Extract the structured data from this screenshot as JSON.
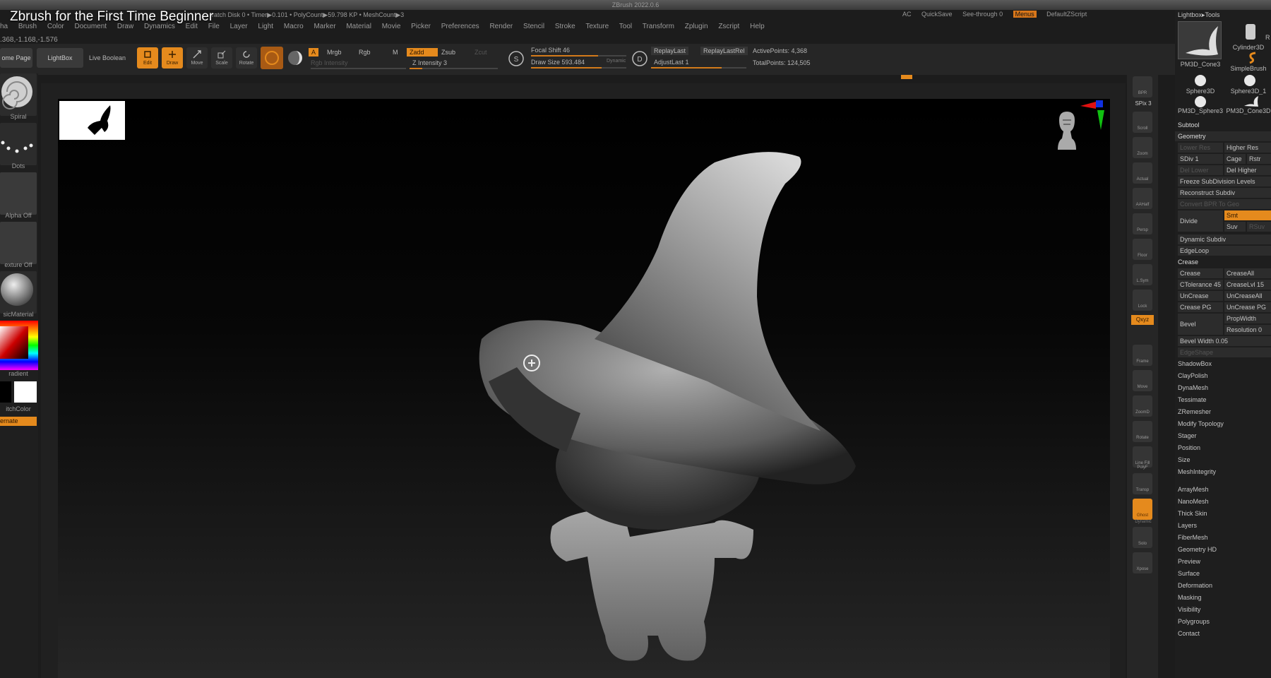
{
  "app": {
    "window_title": "ZBrush 2022.0.6",
    "video_title": "Zbrush for the First Time Beginner",
    "stats": "ratch Disk 0 •  Timer▶0.101 • PolyCount▶59.798 KP • MeshCount▶3",
    "right_info": {
      "ac": "AC",
      "quicksave": "QuickSave",
      "seethrough": "See-through  0",
      "menus": "Menus",
      "script": "DefaultZScript"
    }
  },
  "menubar": [
    "ha",
    "Brush",
    "Color",
    "Document",
    "Draw",
    "Dynamics",
    "Edit",
    "File",
    "Layer",
    "Light",
    "Macro",
    "Marker",
    "Material",
    "Movie",
    "Picker",
    "Preferences",
    "Render",
    "Stencil",
    "Stroke",
    "Texture",
    "Tool",
    "Transform",
    "Zplugin",
    "Zscript",
    "Help"
  ],
  "coords": ".368,-1.168,-1.576",
  "toolbar": {
    "home_page": "ome Page",
    "lightbox": "LightBox",
    "live_boolean": "Live Boolean",
    "tools": [
      {
        "label": "Edit",
        "on": true
      },
      {
        "label": "Draw",
        "on": true
      },
      {
        "label": "Move",
        "on": false
      },
      {
        "label": "Scale",
        "on": false
      },
      {
        "label": "Rotate",
        "on": false
      }
    ],
    "a": "A",
    "mrgb": "Mrgb",
    "rgb": "Rgb",
    "m": "M",
    "rgb_intensity": "Rgb Intensity",
    "zadd": "Zadd",
    "zsub": "Zsub",
    "zcut": "Zcut",
    "z_intensity": "Z Intensity 3",
    "focal_shift": "Focal Shift 46",
    "draw_size": "Draw Size 593.484",
    "dynamic": "Dynamic",
    "replay_last": "ReplayLast",
    "replay_last_rel": "ReplayLastRel",
    "adjust_last": "AdjustLast 1",
    "active_points": "ActivePoints: 4,368",
    "total_points": "TotalPoints: 124,505",
    "s_label": "S",
    "d_label": "D"
  },
  "left_shelf": {
    "brush": "Spiral",
    "stroke": "Dots",
    "alpha": "Alpha Off",
    "texture": "exture Off",
    "material": "sicMaterial",
    "gradient": "radient",
    "switch_color": "itchColor",
    "alternate": "ernate"
  },
  "right_strip": [
    "BPR",
    "SPix 3",
    "Scroll",
    "Zoom",
    "Actual",
    "AAHalf",
    "Persp",
    "Floor",
    "L.Sym",
    "Lock",
    "Qxyz",
    "Frame",
    "Move",
    "ZoomD",
    "Rotate",
    "Line Fill PolyF",
    "Transp",
    "Ghost",
    "Dynamic",
    "Solo",
    "Xpose"
  ],
  "right_panel": {
    "lightbox_tools": "Lightbox▸Tools",
    "thumbs": [
      {
        "label": "PM3D_Cone3"
      },
      {
        "label": "Cylinder3D"
      },
      {
        "label": "SimpleBrush"
      },
      {
        "label": "Sphere3D"
      },
      {
        "label": "Sphere3D_1"
      },
      {
        "label": "PM3D_Sphere3"
      },
      {
        "label": "PM3D_Cone3D"
      }
    ],
    "r_label": "R",
    "subtool": "Subtool",
    "geometry": "Geometry",
    "lower_res": "Lower Res",
    "higher_res": "Higher Res",
    "sdiv": "SDiv 1",
    "cage": "Cage",
    "rstr": "Rstr",
    "del_lower": "Del Lower",
    "del_higher": "Del Higher",
    "freeze": "Freeze SubDivision Levels",
    "reconstruct": "Reconstruct Subdiv",
    "convert_bpr": "Convert BPR To Geo",
    "divide": "Divide",
    "smt": "Smt",
    "suv": "Suv",
    "rsuv": "RSuv",
    "dynamic_subdiv": "Dynamic Subdiv",
    "edgeloop": "EdgeLoop",
    "crease_hdr": "Crease",
    "crease": "Crease",
    "crease_all": "CreaseAll",
    "ctolerance": "CTolerance 45",
    "crease_lvl": "CreaseLvl 15",
    "uncrease": "UnCrease",
    "uncrease_all": "UnCreaseAll",
    "crease_pg": "Crease PG",
    "uncrease_pg": "UnCrease PG",
    "bevel": "Bevel",
    "prop_width": "PropWidth",
    "resolution": "Resolution 0",
    "bevel_width": "Bevel Width 0.05",
    "edge_shape": "EdgeShape",
    "items_geo": [
      "ShadowBox",
      "ClayPolish",
      "DynaMesh",
      "Tessimate",
      "ZRemesher",
      "Modify Topology",
      "Stager",
      "Position",
      "Size",
      "MeshIntegrity"
    ],
    "items_sections": [
      "ArrayMesh",
      "NanoMesh",
      "Thick Skin",
      "Layers",
      "FiberMesh",
      "Geometry HD",
      "Preview",
      "Surface",
      "Deformation",
      "Masking",
      "Visibility",
      "Polygroups",
      "Contact"
    ]
  },
  "colors": {
    "accent": "#e58a1d",
    "canvas": "#000000",
    "panel": "#1e1e1e"
  }
}
